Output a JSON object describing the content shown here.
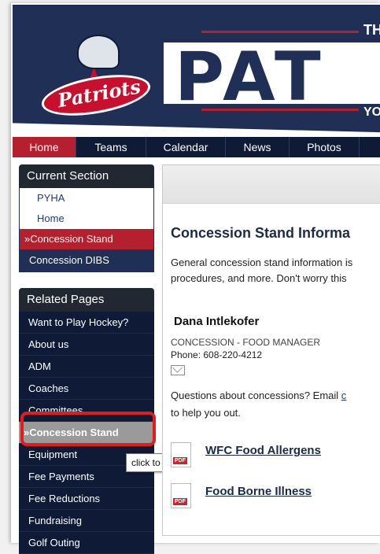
{
  "banner": {
    "logo_text": "Patriots",
    "wordmark": "PAT",
    "top_right": "THE",
    "bottom_right": "YOU"
  },
  "nav": [
    "Home",
    "Teams",
    "Calendar",
    "News",
    "Photos"
  ],
  "current_section": {
    "heading": "Current Section",
    "items": [
      "PYHA",
      "Home"
    ],
    "selected": "»Concession Stand",
    "extra": "Concession DIBS"
  },
  "related_pages": {
    "heading": "Related Pages",
    "items": [
      "Want to Play Hockey?",
      "About us",
      "ADM",
      "Coaches",
      "Committees",
      "»Concession Stand",
      "Equipment",
      "Fee Payments",
      "Fee Reductions",
      "Fundraising",
      "Golf Outing"
    ],
    "highlighted_index": 5
  },
  "tooltip": "click to go to 'Concession Stand'",
  "content": {
    "title": "Concession Stand Informa",
    "desc_line1": "General concession stand information is",
    "desc_line2": "procedures, and more.   Don't worry this",
    "contact_name": "Dana Intlekofer",
    "contact_role": "CONCESSION - FOOD MANAGER",
    "contact_phone": "Phone: 608-220-4212",
    "question_line1": "Questions about concessions?  Email ",
    "question_link": "c",
    "question_line2": "to help you out.",
    "docs": [
      "WFC Food Allergens",
      "Food Borne Illness"
    ],
    "pdf_label": "PDF"
  },
  "colors": {
    "navy": "#1f2f55",
    "red": "#b5202e",
    "highlight_box": "#e21c1c"
  }
}
